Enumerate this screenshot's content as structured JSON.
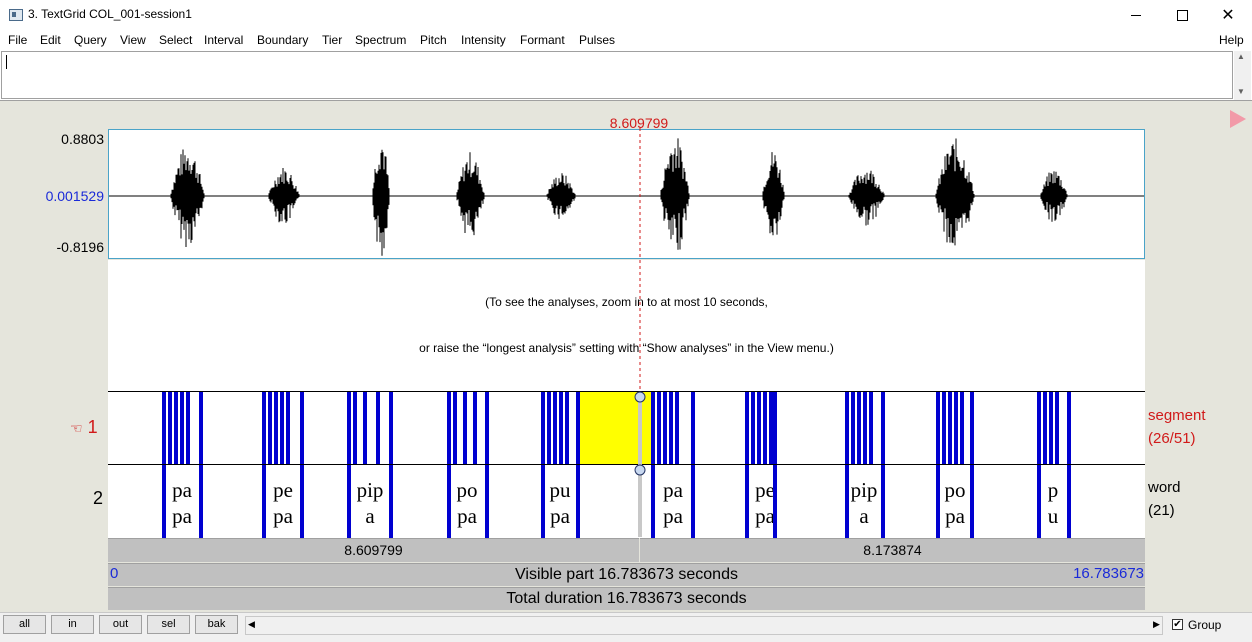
{
  "window": {
    "title": "3. TextGrid COL_001-session1",
    "controls": {
      "minimize": "minimize",
      "maximize": "maximize",
      "close": "✕"
    }
  },
  "menu": [
    "File",
    "Edit",
    "Query",
    "View",
    "Select",
    "Interval",
    "Boundary",
    "Tier",
    "Spectrum",
    "Pitch",
    "Intensity",
    "Formant",
    "Pulses"
  ],
  "help": "Help",
  "text_field": {
    "value": ""
  },
  "waveform": {
    "ymax": "0.8803",
    "yzero": "0.001529",
    "ymin": "-0.8196",
    "cursor_time": "8.609799"
  },
  "analysis_message": {
    "line1": "(To see the analyses, zoom in to at most 10 seconds,",
    "line2": "or raise the “longest analysis” setting with “Show analyses” in the View menu.)"
  },
  "tiers": [
    {
      "number": "1",
      "marker": "☜",
      "name": "segment",
      "count": "(26/51)"
    },
    {
      "number": "2",
      "name": "word",
      "count": "(21)"
    }
  ],
  "words": [
    {
      "line1": "pa",
      "line2": "pa"
    },
    {
      "line1": "pe",
      "line2": "pa"
    },
    {
      "line1": "pip",
      "line2": "a"
    },
    {
      "line1": "po",
      "line2": "pa"
    },
    {
      "line1": "pu",
      "line2": "pa"
    },
    {
      "line1": "pa",
      "line2": "pa"
    },
    {
      "line1": "pe",
      "line2": "pa"
    },
    {
      "line1": "pip",
      "line2": "a"
    },
    {
      "line1": "po",
      "line2": "pa"
    },
    {
      "line1": "p",
      "line2": "u"
    }
  ],
  "time_bars": {
    "left_duration": "8.609799",
    "right_duration": "8.173874",
    "visible_start": "0",
    "visible_end": "16.783673",
    "visible_label": "Visible part 16.783673 seconds",
    "total_label": "Total duration 16.783673 seconds"
  },
  "zoom_buttons": [
    "all",
    "in",
    "out",
    "sel",
    "bak"
  ],
  "group": {
    "label": "Group",
    "checked": true,
    "mark": "✔"
  },
  "colors": {
    "boundary": "#0000d0",
    "selection": "#ffff00",
    "cursor": "#d11a1a",
    "axis_blue": "#1a2ad8"
  }
}
